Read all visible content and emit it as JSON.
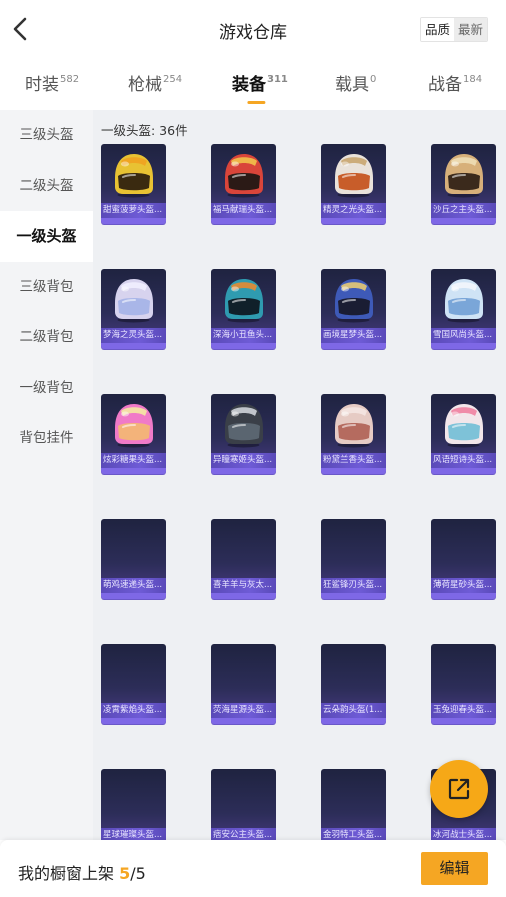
{
  "header": {
    "title": "游戏仓库",
    "sort": [
      "品质",
      "最新"
    ]
  },
  "tabs": [
    {
      "label": "时装",
      "count": "582"
    },
    {
      "label": "枪械",
      "count": "254"
    },
    {
      "label": "装备",
      "count": "311"
    },
    {
      "label": "载具",
      "count": "0"
    },
    {
      "label": "战备",
      "count": "184"
    }
  ],
  "sidebar": {
    "items": [
      "三级头盔",
      "二级头盔",
      "一级头盔",
      "三级背包",
      "二级背包",
      "一级背包",
      "背包挂件"
    ]
  },
  "content": {
    "count_text": "一级头盔: 36件",
    "items": [
      {
        "name": "甜蜜菠萝头盔...",
        "icon": "helmet-icon",
        "shell": "#e8c233",
        "stripe": "#f0a020",
        "visor": "#3a2a10"
      },
      {
        "name": "福马献瑞头盔...",
        "icon": "helmet-icon",
        "shell": "#d9453a",
        "stripe": "#f2c94c",
        "visor": "#2b1a16"
      },
      {
        "name": "精灵之光头盔...",
        "icon": "helmet-icon",
        "shell": "#e9e2da",
        "stripe": "#c7a268",
        "visor": "#c85d2a"
      },
      {
        "name": "沙丘之主头盔...",
        "icon": "helmet-icon",
        "shell": "#d7b07a",
        "stripe": "#f0e0b8",
        "visor": "#3b2a1c"
      },
      {
        "name": "梦海之灵头盔...",
        "icon": "helmet-icon",
        "shell": "#d7d3ee",
        "stripe": "#f2f0ff",
        "visor": "#a9b6e8"
      },
      {
        "name": "深海小丑鱼头...",
        "icon": "helmet-icon",
        "shell": "#2f9bb0",
        "stripe": "#f08a2a",
        "visor": "#10202a"
      },
      {
        "name": "画境星梦头盔...",
        "icon": "helmet-icon",
        "shell": "#3e5ab8",
        "stripe": "#f0d070",
        "visor": "#1a1d33"
      },
      {
        "name": "雪国风尚头盔...",
        "icon": "helmet-icon",
        "shell": "#cfe3f5",
        "stripe": "#f5f7fb",
        "visor": "#7aa6d8"
      },
      {
        "name": "炫彩糖果头盔...",
        "icon": "helmet-icon",
        "shell": "#f07ac8",
        "stripe": "#f5f0a0",
        "visor": "#f3b37a"
      },
      {
        "name": "异瞳寒姬头盔...",
        "icon": "helmet-icon",
        "shell": "#3a3f48",
        "stripe": "#d8dce2",
        "visor": "#5a6570"
      },
      {
        "name": "粉黛兰香头盔...",
        "icon": "helmet-icon",
        "shell": "#e6cbc4",
        "stripe": "#f5e8e4",
        "visor": "#b56b5f"
      },
      {
        "name": "风语短诗头盔...",
        "icon": "helmet-icon",
        "shell": "#f2e6ea",
        "stripe": "#f07a9c",
        "visor": "#7ec2d8"
      },
      {
        "name": "萌鸡速递头盔...",
        "icon": ""
      },
      {
        "name": "喜羊羊与灰太...",
        "icon": ""
      },
      {
        "name": "狂鲨锋刃头盔...",
        "icon": ""
      },
      {
        "name": "薄荷星砂头盔...",
        "icon": ""
      },
      {
        "name": "凌霄紫焰头盔...",
        "icon": ""
      },
      {
        "name": "荧海星源头盔...",
        "icon": ""
      },
      {
        "name": "云朵韵头盔(1...",
        "icon": ""
      },
      {
        "name": "玉兔迎春头盔...",
        "icon": ""
      },
      {
        "name": "星球璀璨头盔...",
        "icon": ""
      },
      {
        "name": "痞安公主头盔...",
        "icon": ""
      },
      {
        "name": "金羽特工头盔...",
        "icon": ""
      },
      {
        "name": "冰河战士头盔...",
        "icon": ""
      }
    ]
  },
  "bottom": {
    "shelf_label": "我的橱窗上架 ",
    "shelf_current": "5",
    "shelf_total": "/5",
    "edit_label": "编辑"
  },
  "colors": {
    "accent": "#f5a623"
  }
}
